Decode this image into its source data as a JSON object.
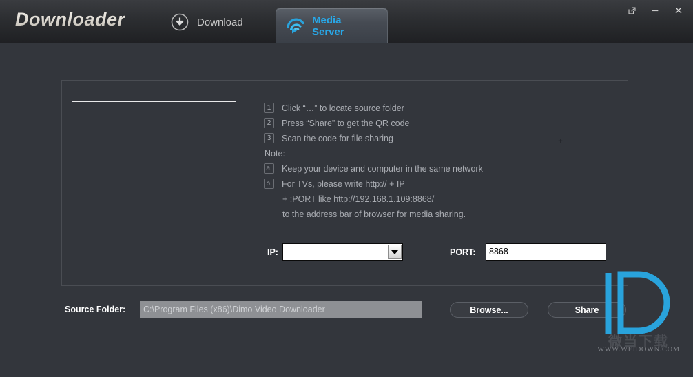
{
  "window": {
    "app_title": "Downloader",
    "controls": [
      {
        "name": "restore-window",
        "icon": "external-link-icon"
      },
      {
        "name": "minimize-window",
        "icon": "minimize-icon"
      },
      {
        "name": "close-window",
        "icon": "close-icon"
      }
    ]
  },
  "tabs": [
    {
      "label": "Download",
      "icon": "download-circle-icon",
      "active": false
    },
    {
      "label": "Media Server",
      "icon": "cast-icon",
      "active": true
    }
  ],
  "instructions": {
    "steps": [
      {
        "badge": "1",
        "text": "Click “…” to locate source folder"
      },
      {
        "badge": "2",
        "text": "Press “Share” to get the QR code"
      },
      {
        "badge": "3",
        "text": "Scan the code for file sharing"
      }
    ],
    "note_label": "Note:",
    "notes": [
      {
        "badge": "a.",
        "text": "Keep your device and computer in the same network"
      },
      {
        "badge": "b.",
        "text": "For TVs, please write http:// + IP"
      }
    ],
    "continuations": [
      "+ :PORT like http://192.168.1.109:8868/",
      "to the address bar of browser for media sharing."
    ]
  },
  "fields": {
    "ip_label": "IP:",
    "ip_value": "",
    "port_label": "PORT:",
    "port_value": "8868",
    "source_folder_label": "Source Folder:",
    "source_folder_value": "C:\\Program Files (x86)\\Dimo Video Downloader"
  },
  "buttons": {
    "browse": "Browse...",
    "share": "Share"
  },
  "watermark": {
    "cn_text": "微当下载",
    "url_text": "WWW.WEIDOWN.COM",
    "logo_color": "#29a3dc"
  },
  "colors": {
    "accent": "#28a8e8",
    "body_bg": "#33363c",
    "header_bg": "#2c2e31",
    "text_muted": "#a9acb2"
  }
}
